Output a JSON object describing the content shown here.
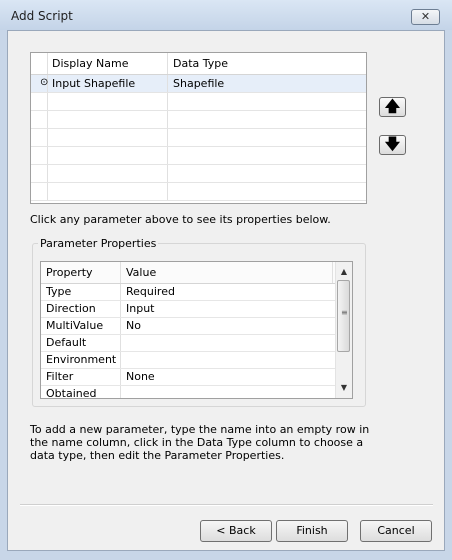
{
  "window": {
    "title": "Add Script"
  },
  "parameters": {
    "headers": [
      "Display Name",
      "Data Type"
    ],
    "rows": [
      {
        "marker": "⊙",
        "name": "Input Shapefile",
        "type": "Shapefile"
      },
      {
        "marker": "",
        "name": "",
        "type": ""
      },
      {
        "marker": "",
        "name": "",
        "type": ""
      },
      {
        "marker": "",
        "name": "",
        "type": ""
      },
      {
        "marker": "",
        "name": "",
        "type": ""
      },
      {
        "marker": "",
        "name": "",
        "type": ""
      },
      {
        "marker": "",
        "name": "",
        "type": ""
      }
    ]
  },
  "hint": "Click any parameter above to see its properties below.",
  "properties": {
    "group_label": "Parameter Properties",
    "headers": [
      "Property",
      "Value"
    ],
    "rows": [
      {
        "property": "Type",
        "value": "Required"
      },
      {
        "property": "Direction",
        "value": "Input"
      },
      {
        "property": "MultiValue",
        "value": "No"
      },
      {
        "property": "Default",
        "value": ""
      },
      {
        "property": "Environment",
        "value": ""
      },
      {
        "property": "Filter",
        "value": "None"
      },
      {
        "property": "Obtained from",
        "value": ""
      }
    ]
  },
  "instructions": "To add a new parameter, type the name into an empty row in the name column, click in the Data Type column to choose a data type, then edit the Parameter Properties.",
  "buttons": {
    "back": "< Back",
    "finish": "Finish",
    "cancel": "Cancel"
  },
  "icons": {
    "close": "close-icon",
    "move_up": "arrow-up-icon",
    "move_down": "arrow-down-icon",
    "scroll_up": "scroll-up-icon",
    "scroll_down": "scroll-down-icon"
  },
  "colors": {
    "title_bar": "#c4d4e8",
    "dialog_bg": "#f0f0f0",
    "selected_row": "#e6eef9"
  }
}
